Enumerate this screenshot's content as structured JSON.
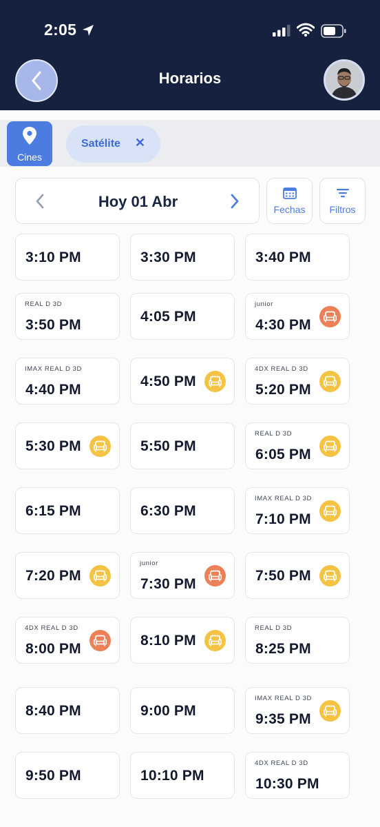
{
  "status": {
    "time": "2:05"
  },
  "header": {
    "title": "Horarios"
  },
  "location": {
    "cines_label": "Cines",
    "chip_label": "Satélite",
    "chip_close": "✕"
  },
  "date_nav": {
    "label": "Hoy 01 Abr"
  },
  "tools": {
    "fechas": "Fechas",
    "filtros": "Filtros"
  },
  "colors": {
    "header_bg": "#16213f",
    "accent": "#4c7ce0",
    "seat_yellow": "#f5c343",
    "seat_orange": "#ec8057"
  },
  "showtimes": [
    {
      "time": "3:10 PM",
      "format": "",
      "seat": ""
    },
    {
      "time": "3:30 PM",
      "format": "",
      "seat": ""
    },
    {
      "time": "3:40 PM",
      "format": "",
      "seat": ""
    },
    {
      "time": "3:50 PM",
      "format": "REAL D 3D",
      "seat": ""
    },
    {
      "time": "4:05 PM",
      "format": "",
      "seat": ""
    },
    {
      "time": "4:30 PM",
      "format": "junior",
      "seat": "orange"
    },
    {
      "time": "4:40 PM",
      "format": "IMAX REAL D 3D",
      "seat": ""
    },
    {
      "time": "4:50 PM",
      "format": "",
      "seat": "yellow"
    },
    {
      "time": "5:20 PM",
      "format": "4DX REAL D 3D",
      "seat": "yellow"
    },
    {
      "time": "5:30 PM",
      "format": "",
      "seat": "yellow"
    },
    {
      "time": "5:50 PM",
      "format": "",
      "seat": ""
    },
    {
      "time": "6:05 PM",
      "format": "REAL D 3D",
      "seat": "yellow"
    },
    {
      "time": "6:15 PM",
      "format": "",
      "seat": ""
    },
    {
      "time": "6:30 PM",
      "format": "",
      "seat": ""
    },
    {
      "time": "7:10 PM",
      "format": "IMAX REAL D 3D",
      "seat": "yellow"
    },
    {
      "time": "7:20 PM",
      "format": "",
      "seat": "yellow"
    },
    {
      "time": "7:30 PM",
      "format": "junior",
      "seat": "orange"
    },
    {
      "time": "7:50 PM",
      "format": "",
      "seat": "yellow"
    },
    {
      "time": "8:00 PM",
      "format": "4DX REAL D 3D",
      "seat": "orange"
    },
    {
      "time": "8:10 PM",
      "format": "",
      "seat": "yellow"
    },
    {
      "time": "8:25 PM",
      "format": "REAL D 3D",
      "seat": ""
    },
    {
      "time": "8:40 PM",
      "format": "",
      "seat": ""
    },
    {
      "time": "9:00 PM",
      "format": "",
      "seat": ""
    },
    {
      "time": "9:35 PM",
      "format": "IMAX REAL D 3D",
      "seat": "yellow"
    },
    {
      "time": "9:50 PM",
      "format": "",
      "seat": ""
    },
    {
      "time": "10:10 PM",
      "format": "",
      "seat": ""
    },
    {
      "time": "10:30 PM",
      "format": "4DX REAL D 3D",
      "seat": ""
    }
  ]
}
